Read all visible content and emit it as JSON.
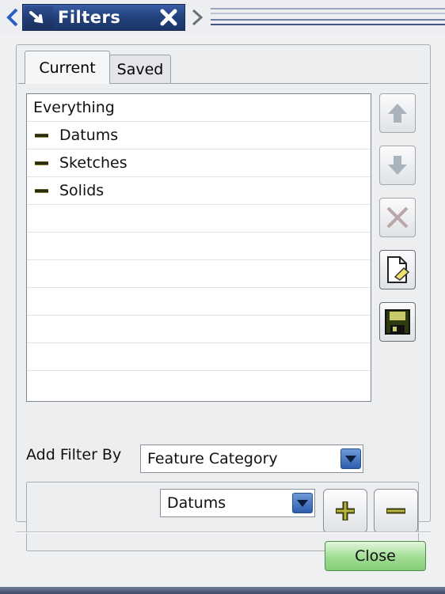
{
  "window": {
    "title": "Filters",
    "icons": {
      "collapse_left": "chevron-left-icon",
      "grip": "drag-arrow-icon",
      "close": "close-icon",
      "expand_right": "chevron-right-icon"
    }
  },
  "tabs": [
    {
      "label": "Current",
      "active": true
    },
    {
      "label": "Saved",
      "active": false
    }
  ],
  "filter_list": {
    "items": [
      {
        "label": "Everything",
        "level": 0
      },
      {
        "label": "Datums",
        "level": 1
      },
      {
        "label": "Sketches",
        "level": 1
      },
      {
        "label": "Solids",
        "level": 1
      }
    ]
  },
  "side_actions": [
    {
      "name": "move-up",
      "icon": "arrow-up-icon",
      "enabled": false
    },
    {
      "name": "move-down",
      "icon": "arrow-down-icon",
      "enabled": false
    },
    {
      "name": "remove",
      "icon": "delete-x-icon",
      "enabled": false
    },
    {
      "name": "new-filter",
      "icon": "new-document-icon",
      "enabled": true
    },
    {
      "name": "save-filter",
      "icon": "save-disk-icon",
      "enabled": true
    }
  ],
  "add_filter": {
    "label": "Add Filter By",
    "selected": "Feature Category",
    "value_selected": "Datums"
  },
  "buttons": {
    "close": "Close"
  },
  "colors": {
    "title_bg": "#23427e",
    "close_button": "#9fdc92",
    "dropdown_arrow": "#2d5fae"
  }
}
